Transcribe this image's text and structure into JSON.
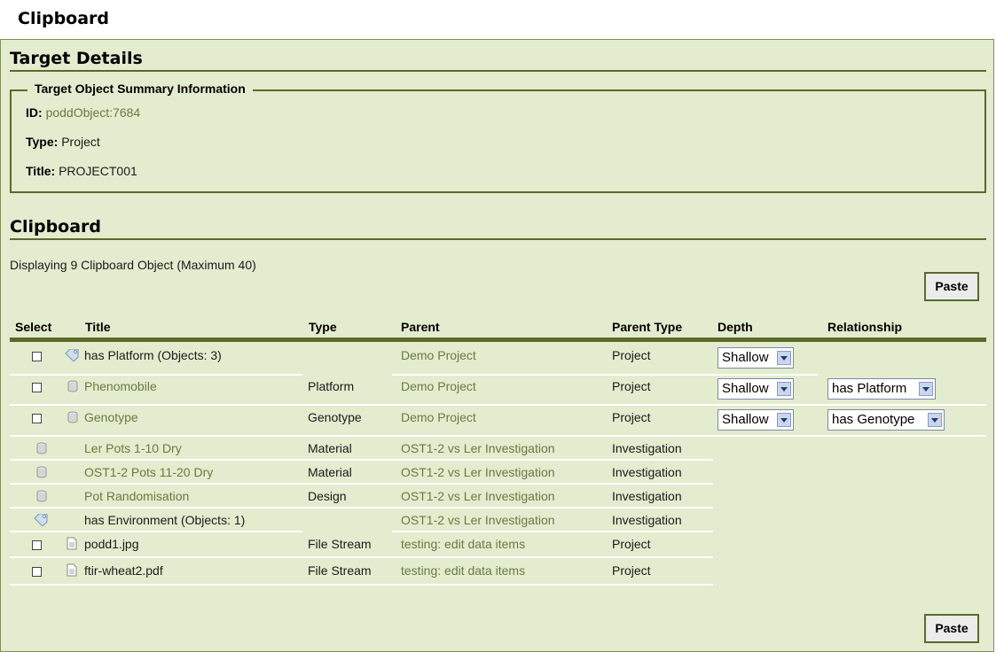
{
  "page": {
    "title": "Clipboard"
  },
  "target": {
    "heading": "Target Details",
    "legend": "Target Object Summary Information",
    "id_label": "ID:",
    "id_value": "poddObject:7684",
    "type_label": "Type:",
    "type_value": "Project",
    "title_label": "Title:",
    "title_value": "PROJECT001"
  },
  "clipboard": {
    "heading": "Clipboard",
    "displaying": "Displaying 9 Clipboard Object (Maximum 40)",
    "paste_label": "Paste",
    "columns": {
      "select": "Select",
      "title": "Title",
      "type": "Type",
      "parent": "Parent",
      "parent_type": "Parent Type",
      "depth": "Depth",
      "relationship": "Relationship"
    },
    "rows": [
      {
        "title": "has Platform (Objects: 3)",
        "type": "",
        "parent": "Demo Project",
        "parent_type": "Project",
        "depth": "Shallow",
        "relationship": "",
        "icon": "tag-icon"
      },
      {
        "title": "Phenomobile",
        "type": "Platform",
        "parent": "Demo Project",
        "parent_type": "Project",
        "depth": "Shallow",
        "relationship": "has Platform",
        "icon": "cylinder-icon"
      },
      {
        "title": "Genotype",
        "type": "Genotype",
        "parent": "Demo Project",
        "parent_type": "Project",
        "depth": "Shallow",
        "relationship": "has Genotype",
        "icon": "cylinder-icon"
      },
      {
        "title": "Ler Pots 1-10 Dry",
        "type": "Material",
        "parent": "OST1-2 vs Ler Investigation",
        "parent_type": "Investigation",
        "icon": "cylinder-icon"
      },
      {
        "title": "OST1-2 Pots 11-20 Dry",
        "type": "Material",
        "parent": "OST1-2 vs Ler Investigation",
        "parent_type": "Investigation",
        "icon": "cylinder-icon"
      },
      {
        "title": "Pot Randomisation",
        "type": "Design",
        "parent": "OST1-2 vs Ler Investigation",
        "parent_type": "Investigation",
        "icon": "cylinder-icon"
      },
      {
        "title": "has Environment (Objects: 1)",
        "type": "",
        "parent": "OST1-2 vs Ler Investigation",
        "parent_type": "Investigation",
        "icon": "tag-icon"
      },
      {
        "title": "podd1.jpg",
        "type": "File Stream",
        "parent": "testing: edit data items",
        "parent_type": "Project",
        "icon": "file-icon"
      },
      {
        "title": "ftir-wheat2.pdf",
        "type": "File Stream",
        "parent": "testing: edit data items",
        "parent_type": "Project",
        "icon": "file-icon"
      }
    ]
  }
}
